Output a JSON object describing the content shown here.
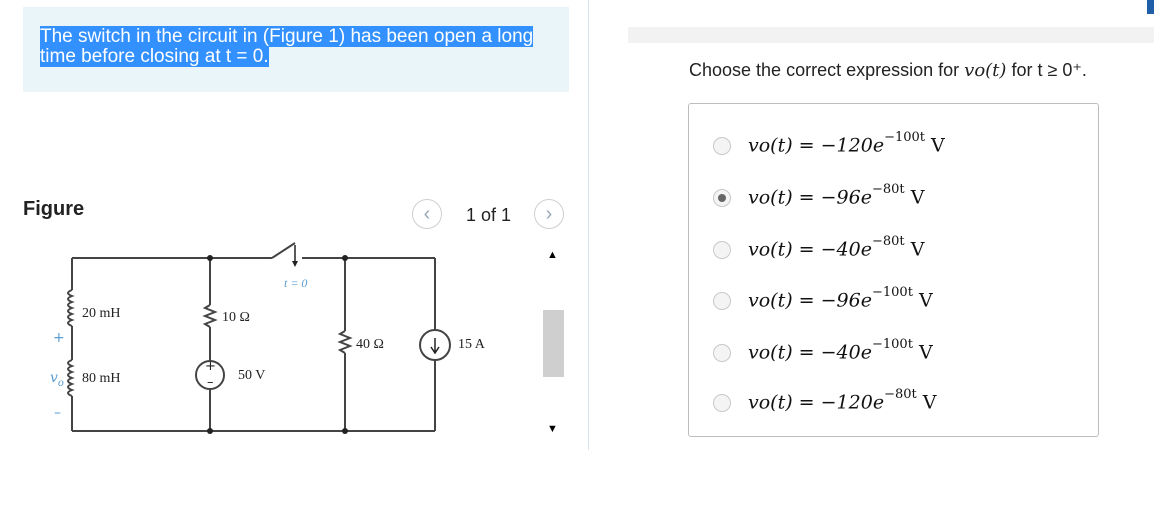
{
  "prompt": {
    "line1": "The switch in the circuit in (Figure 1) has been open a long",
    "line2": "time before closing at t = 0."
  },
  "figure": {
    "title": "Figure",
    "pager": "1 of 1",
    "circuit": {
      "l1": "20 mH",
      "l2": "80 mH",
      "r1": "10 Ω",
      "src_v": "50 V",
      "switch": "t = 0",
      "r2": "40 Ω",
      "src_i": "15 A",
      "plus": "+",
      "minus": "–",
      "vo": "v",
      "vo_sub": "o"
    }
  },
  "question": {
    "text": "Choose the correct expression for",
    "func": "vo(t)",
    "cond": "for t ≥ 0⁺."
  },
  "options": [
    {
      "base": "vo(t) = −120e",
      "exp": "−100t",
      "unit": " V",
      "selected": false
    },
    {
      "base": "vo(t) = −96e",
      "exp": "−80t",
      "unit": " V",
      "selected": true
    },
    {
      "base": "vo(t) = −40e",
      "exp": "−80t",
      "unit": " V",
      "selected": false
    },
    {
      "base": "vo(t) = −96e",
      "exp": "−100t",
      "unit": " V",
      "selected": false
    },
    {
      "base": "vo(t) = −40e",
      "exp": "−100t",
      "unit": " V",
      "selected": false
    },
    {
      "base": "vo(t) = −120e",
      "exp": "−80t",
      "unit": " V",
      "selected": false
    }
  ]
}
